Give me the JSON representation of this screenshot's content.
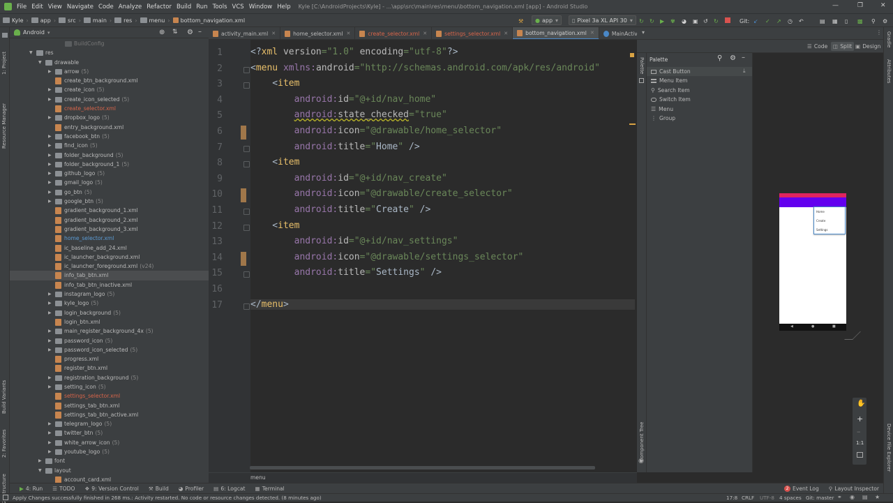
{
  "menubar": {
    "items": [
      "File",
      "Edit",
      "View",
      "Navigate",
      "Code",
      "Analyze",
      "Refactor",
      "Build",
      "Run",
      "Tools",
      "VCS",
      "Window",
      "Help"
    ],
    "window_title": "Kyle [C:\\AndroidProjects\\Kyle] - ...\\app\\src\\main\\res\\menu\\bottom_navigation.xml [app] - Android Studio"
  },
  "navbar": {
    "breadcrumbs": [
      "Kyle",
      "app",
      "src",
      "main",
      "res",
      "menu",
      "bottom_navigation.xml"
    ],
    "run_config": "app",
    "device": "Pixel 3a XL API 30",
    "git_label": "Git:"
  },
  "left_strip": {
    "project": "1: Project",
    "resource_manager": "Resource Manager",
    "build_variants": "Build Variants",
    "favorites": "2: Favorites",
    "structure": "Z: Structure"
  },
  "right_strip": {
    "gradle": "Gradle",
    "attributes": "Attributes",
    "device_file_explorer": "Device File Explorer"
  },
  "project_panel": {
    "view_selector": "Android",
    "rows": [
      {
        "label": "BuildConfig",
        "count": "",
        "type": "gray",
        "depth": 4,
        "arrow": ""
      },
      {
        "label": "res",
        "count": "",
        "type": "folder",
        "depth": 1,
        "arrow": "down"
      },
      {
        "label": "drawable",
        "count": "",
        "type": "folder",
        "depth": 2,
        "arrow": "down"
      },
      {
        "label": "arrow",
        "count": "(5)",
        "type": "folder",
        "depth": 3,
        "arrow": "right"
      },
      {
        "label": "create_btn_background.xml",
        "count": "",
        "type": "xml",
        "depth": 3,
        "arrow": ""
      },
      {
        "label": "create_icon",
        "count": "(5)",
        "type": "folder",
        "depth": 3,
        "arrow": "right"
      },
      {
        "label": "create_icon_selected",
        "count": "(5)",
        "type": "folder",
        "depth": 3,
        "arrow": "right"
      },
      {
        "label": "create_selector.xml",
        "count": "",
        "type": "xml-red",
        "depth": 3,
        "arrow": ""
      },
      {
        "label": "dropbox_logo",
        "count": "(5)",
        "type": "folder",
        "depth": 3,
        "arrow": "right"
      },
      {
        "label": "entry_background.xml",
        "count": "",
        "type": "xml",
        "depth": 3,
        "arrow": ""
      },
      {
        "label": "facebook_btn",
        "count": "(5)",
        "type": "folder",
        "depth": 3,
        "arrow": "right"
      },
      {
        "label": "find_icon",
        "count": "(5)",
        "type": "folder",
        "depth": 3,
        "arrow": "right"
      },
      {
        "label": "folder_background",
        "count": "(5)",
        "type": "folder",
        "depth": 3,
        "arrow": "right"
      },
      {
        "label": "folder_background_1",
        "count": "(5)",
        "type": "folder",
        "depth": 3,
        "arrow": "right"
      },
      {
        "label": "github_logo",
        "count": "(5)",
        "type": "folder",
        "depth": 3,
        "arrow": "right"
      },
      {
        "label": "gmail_logo",
        "count": "(5)",
        "type": "folder",
        "depth": 3,
        "arrow": "right"
      },
      {
        "label": "go_btn",
        "count": "(5)",
        "type": "folder",
        "depth": 3,
        "arrow": "right"
      },
      {
        "label": "google_btn",
        "count": "(5)",
        "type": "folder",
        "depth": 3,
        "arrow": "right"
      },
      {
        "label": "gradient_background_1.xml",
        "count": "",
        "type": "xml",
        "depth": 3,
        "arrow": ""
      },
      {
        "label": "gradient_background_2.xml",
        "count": "",
        "type": "xml",
        "depth": 3,
        "arrow": ""
      },
      {
        "label": "gradient_background_3.xml",
        "count": "",
        "type": "xml",
        "depth": 3,
        "arrow": ""
      },
      {
        "label": "home_selector.xml",
        "count": "",
        "type": "xml-blue",
        "depth": 3,
        "arrow": ""
      },
      {
        "label": "ic_baseline_add_24.xml",
        "count": "",
        "type": "xml",
        "depth": 3,
        "arrow": ""
      },
      {
        "label": "ic_launcher_background.xml",
        "count": "",
        "type": "xml",
        "depth": 3,
        "arrow": ""
      },
      {
        "label": "ic_launcher_foreground.xml",
        "count": "(v24)",
        "type": "xml",
        "depth": 3,
        "arrow": ""
      },
      {
        "label": "info_tab_btn.xml",
        "count": "",
        "type": "xml",
        "depth": 3,
        "arrow": "",
        "selected": true
      },
      {
        "label": "info_tab_btn_inactive.xml",
        "count": "",
        "type": "xml",
        "depth": 3,
        "arrow": ""
      },
      {
        "label": "instagram_logo",
        "count": "(5)",
        "type": "folder",
        "depth": 3,
        "arrow": "right"
      },
      {
        "label": "kyle_logo",
        "count": "(5)",
        "type": "folder",
        "depth": 3,
        "arrow": "right"
      },
      {
        "label": "login_background",
        "count": "(5)",
        "type": "folder",
        "depth": 3,
        "arrow": "right"
      },
      {
        "label": "login_btn.xml",
        "count": "",
        "type": "xml",
        "depth": 3,
        "arrow": ""
      },
      {
        "label": "main_register_background_4x",
        "count": "(5)",
        "type": "folder",
        "depth": 3,
        "arrow": "right"
      },
      {
        "label": "password_icon",
        "count": "(5)",
        "type": "folder",
        "depth": 3,
        "arrow": "right"
      },
      {
        "label": "password_icon_selected",
        "count": "(5)",
        "type": "folder",
        "depth": 3,
        "arrow": "right"
      },
      {
        "label": "progress.xml",
        "count": "",
        "type": "xml",
        "depth": 3,
        "arrow": ""
      },
      {
        "label": "register_btn.xml",
        "count": "",
        "type": "xml",
        "depth": 3,
        "arrow": ""
      },
      {
        "label": "registration_background",
        "count": "(5)",
        "type": "folder",
        "depth": 3,
        "arrow": "right"
      },
      {
        "label": "setting_icon",
        "count": "(5)",
        "type": "folder",
        "depth": 3,
        "arrow": "right"
      },
      {
        "label": "settings_selector.xml",
        "count": "",
        "type": "xml-red",
        "depth": 3,
        "arrow": ""
      },
      {
        "label": "settings_tab_btn.xml",
        "count": "",
        "type": "xml",
        "depth": 3,
        "arrow": ""
      },
      {
        "label": "settings_tab_btn_active.xml",
        "count": "",
        "type": "xml",
        "depth": 3,
        "arrow": ""
      },
      {
        "label": "telegram_logo",
        "count": "(5)",
        "type": "folder",
        "depth": 3,
        "arrow": "right"
      },
      {
        "label": "twitter_btn",
        "count": "(5)",
        "type": "folder",
        "depth": 3,
        "arrow": "right"
      },
      {
        "label": "white_arrow_icon",
        "count": "(5)",
        "type": "folder",
        "depth": 3,
        "arrow": "right"
      },
      {
        "label": "youtube_logo",
        "count": "(5)",
        "type": "folder",
        "depth": 3,
        "arrow": "right"
      },
      {
        "label": "font",
        "count": "",
        "type": "folder",
        "depth": 2,
        "arrow": "right"
      },
      {
        "label": "layout",
        "count": "",
        "type": "folder",
        "depth": 2,
        "arrow": "down"
      },
      {
        "label": "account_card.xml",
        "count": "",
        "type": "xml",
        "depth": 3,
        "arrow": ""
      }
    ]
  },
  "editor_tabs": [
    {
      "label": "activity_main.xml",
      "kind": "xml",
      "active": false
    },
    {
      "label": "home_selector.xml",
      "kind": "xml",
      "active": false
    },
    {
      "label": "create_selector.xml",
      "kind": "xml",
      "active": false
    },
    {
      "label": "settings_selector.xml",
      "kind": "xml",
      "active": false
    },
    {
      "label": "bottom_navigation.xml",
      "kind": "xml",
      "active": true
    },
    {
      "label": "MainActivity.java",
      "kind": "java",
      "active": false
    }
  ],
  "view_modes": {
    "code": "Code",
    "split": "Split",
    "design": "Design"
  },
  "editor": {
    "lines": [
      [
        [
          "p",
          "<?"
        ],
        [
          "k",
          "xml "
        ],
        [
          "a",
          "version"
        ],
        [
          "s",
          "=\"1.0\" "
        ],
        [
          "a",
          "encoding"
        ],
        [
          "s",
          "=\"utf-8\""
        ],
        [
          "p",
          "?>"
        ]
      ],
      [
        [
          "p",
          "<"
        ],
        [
          "k",
          "menu "
        ],
        [
          "ns",
          "xmlns:"
        ],
        [
          "a",
          "android"
        ],
        [
          "s",
          "=\"http://schemas.android.com/apk/res/android\""
        ]
      ],
      [
        [
          "p",
          "    <"
        ],
        [
          "k",
          "item"
        ]
      ],
      [
        [
          "p",
          "        "
        ],
        [
          "ns",
          "android:"
        ],
        [
          "a",
          "id"
        ],
        [
          "s",
          "=\"@+id/nav_home\""
        ]
      ],
      [
        [
          "p",
          "        "
        ],
        [
          "nsw",
          "android:"
        ],
        [
          "aw",
          "state_checked"
        ],
        [
          "s",
          "=\"true\""
        ]
      ],
      [
        [
          "p",
          "        "
        ],
        [
          "ns",
          "android:"
        ],
        [
          "a",
          "icon"
        ],
        [
          "s",
          "=\"@drawable/home_selector\""
        ]
      ],
      [
        [
          "p",
          "        "
        ],
        [
          "ns",
          "android:"
        ],
        [
          "a",
          "title"
        ],
        [
          "s",
          "=\""
        ],
        [
          "p",
          "Home"
        ],
        [
          "s",
          "\" "
        ],
        [
          "p",
          "/>"
        ]
      ],
      [
        [
          "p",
          "    <"
        ],
        [
          "k",
          "item"
        ]
      ],
      [
        [
          "p",
          "        "
        ],
        [
          "ns",
          "android:"
        ],
        [
          "a",
          "id"
        ],
        [
          "s",
          "=\"@+id/nav_create\""
        ]
      ],
      [
        [
          "p",
          "        "
        ],
        [
          "ns",
          "android:"
        ],
        [
          "a",
          "icon"
        ],
        [
          "s",
          "=\"@drawable/create_selector\""
        ]
      ],
      [
        [
          "p",
          "        "
        ],
        [
          "ns",
          "android:"
        ],
        [
          "a",
          "title"
        ],
        [
          "s",
          "=\""
        ],
        [
          "p",
          "Create"
        ],
        [
          "s",
          "\" "
        ],
        [
          "p",
          "/>"
        ]
      ],
      [
        [
          "p",
          "    <"
        ],
        [
          "k",
          "item"
        ]
      ],
      [
        [
          "p",
          "        "
        ],
        [
          "ns",
          "android:"
        ],
        [
          "a",
          "id"
        ],
        [
          "s",
          "=\"@+id/nav_settings\""
        ]
      ],
      [
        [
          "p",
          "        "
        ],
        [
          "ns",
          "android:"
        ],
        [
          "a",
          "icon"
        ],
        [
          "s",
          "=\"@drawable/settings_selector\""
        ]
      ],
      [
        [
          "p",
          "        "
        ],
        [
          "ns",
          "android:"
        ],
        [
          "a",
          "title"
        ],
        [
          "s",
          "=\""
        ],
        [
          "p",
          "Settings"
        ],
        [
          "s",
          "\" "
        ],
        [
          "p",
          "/>"
        ]
      ],
      [
        [
          "p",
          ""
        ]
      ],
      [
        [
          "p",
          "</"
        ],
        [
          "k",
          "menu"
        ],
        [
          "p",
          ">"
        ]
      ]
    ],
    "breadcrumb": "menu"
  },
  "palette": {
    "title": "Palette",
    "items": [
      "Cast Button",
      "Menu Item",
      "Search Item",
      "Switch Item",
      "Menu",
      "Group"
    ],
    "side_label": "Palette",
    "component_tree_label": "Component Tree"
  },
  "preview": {
    "phone_items": [
      "Home",
      "Create",
      "Settings"
    ],
    "zoom_ratio": "1:1"
  },
  "bottom_tools": {
    "run": "4: Run",
    "todo": "TODO",
    "version_control": "9: Version Control",
    "build": "Build",
    "profiler": "Profiler",
    "logcat": "6: Logcat",
    "terminal": "Terminal",
    "event_log": "Event Log",
    "event_log_count": "2",
    "layout_inspector": "Layout Inspector"
  },
  "status": {
    "message": "Apply Changes successfully finished in 268 ms.: Activity restarted. No code or resource changes detected. (8 minutes ago)",
    "position": "17:8",
    "line_sep": "CRLF",
    "encoding": "UTF-8",
    "indent": "4 spaces",
    "branch": "Git: master"
  },
  "colors": {
    "accent": "#4a88c7",
    "tag": "#e8bf6a",
    "string": "#6a8759",
    "namespace": "#9876aa",
    "app_bar": "#6200ee",
    "status_bar": "#e0245e"
  }
}
